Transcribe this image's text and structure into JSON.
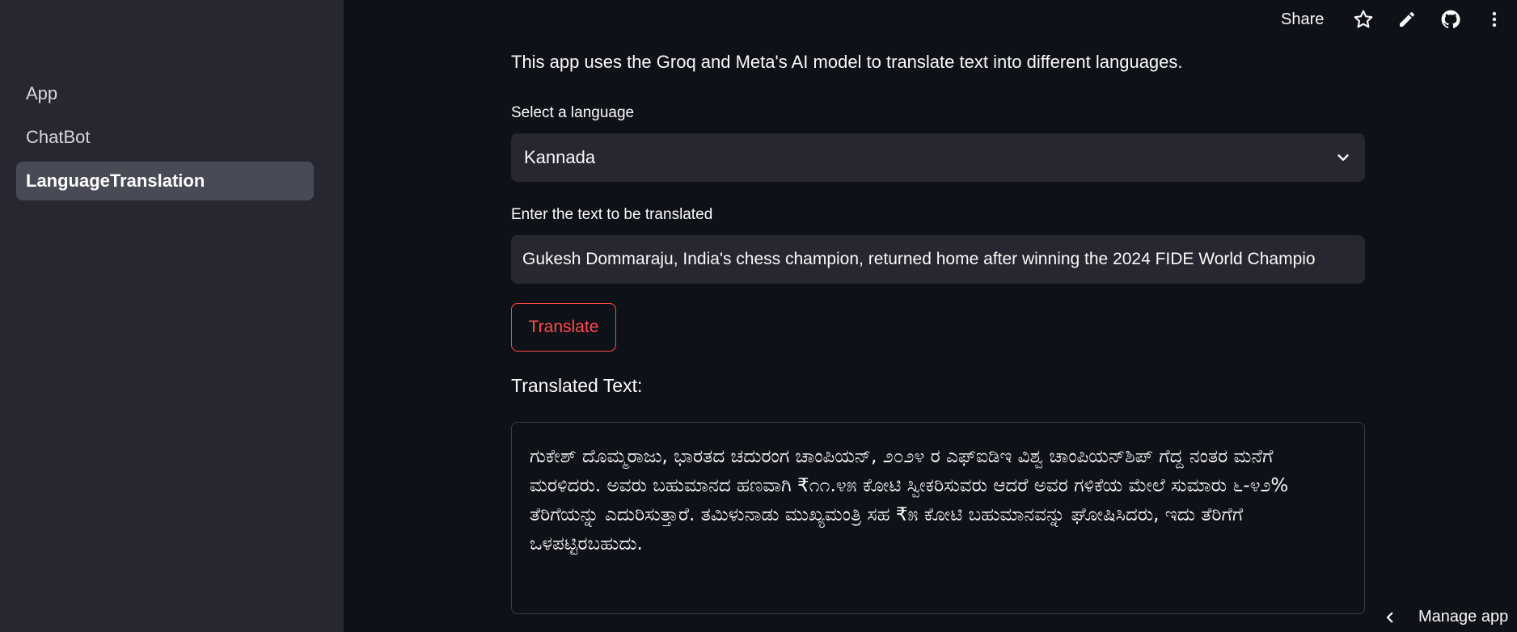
{
  "sidebar": {
    "items": [
      {
        "label": "App",
        "active": false
      },
      {
        "label": "ChatBot",
        "active": false
      },
      {
        "label": "LanguageTranslation",
        "active": true
      }
    ]
  },
  "header": {
    "share_label": "Share",
    "icons": [
      "star-icon",
      "pencil-icon",
      "github-icon",
      "more-vertical-icon"
    ]
  },
  "main": {
    "intro": "This app uses the Groq and Meta's AI model to translate text into different languages.",
    "language_label": "Select a language",
    "language_value": "Kannada",
    "text_label": "Enter the text to be translated",
    "text_value": "Gukesh Dommaraju, India's chess champion, returned home after winning the 2024 FIDE World Champio",
    "translate_label": "Translate",
    "result_heading": "Translated Text:",
    "result_text": "ಗುಕೇಶ್ ದೊಮ್ಮರಾಜು, ಭಾರತದ ಚದುರಂಗ ಚಾಂಪಿಯನ್, ೨೦೨೪ ರ ಎಫ್‌ಐಡಿಇ ವಿಶ್ವ ಚಾಂಪಿಯನ್‌ಶಿಪ್ ಗೆದ್ದ ನಂತರ ಮನೆಗೆ ಮರಳಿದರು. ಅವರು ಬಹುಮಾನದ ಹಣವಾಗಿ ₹೧೧.೪೫ ಕೋಟಿ ಸ್ವೀಕರಿಸುವರು ಆದರೆ ಅವರ ಗಳಿಕೆಯ ಮೇಲೆ ಸುಮಾರು ೬-೪೨% ತೆರಿಗೆಯನ್ನು ಎದುರಿಸುತ್ತಾರೆ. ತಮಿಳುನಾಡು ಮುಖ್ಯಮಂತ್ರಿ ಸಹ ₹೫ ಕೋಟಿ ಬಹುಮಾನವನ್ನು ಘೋಷಿಸಿದರು, ಇದು ತೆರಿಗೆಗೆ ಒಳಪಟ್ಟಿರಬಹುದು."
  },
  "footer": {
    "manage_app_label": "Manage app"
  },
  "colors": {
    "background": "#0e1117",
    "sidebar": "#262730",
    "accent": "#ff4b4b"
  }
}
